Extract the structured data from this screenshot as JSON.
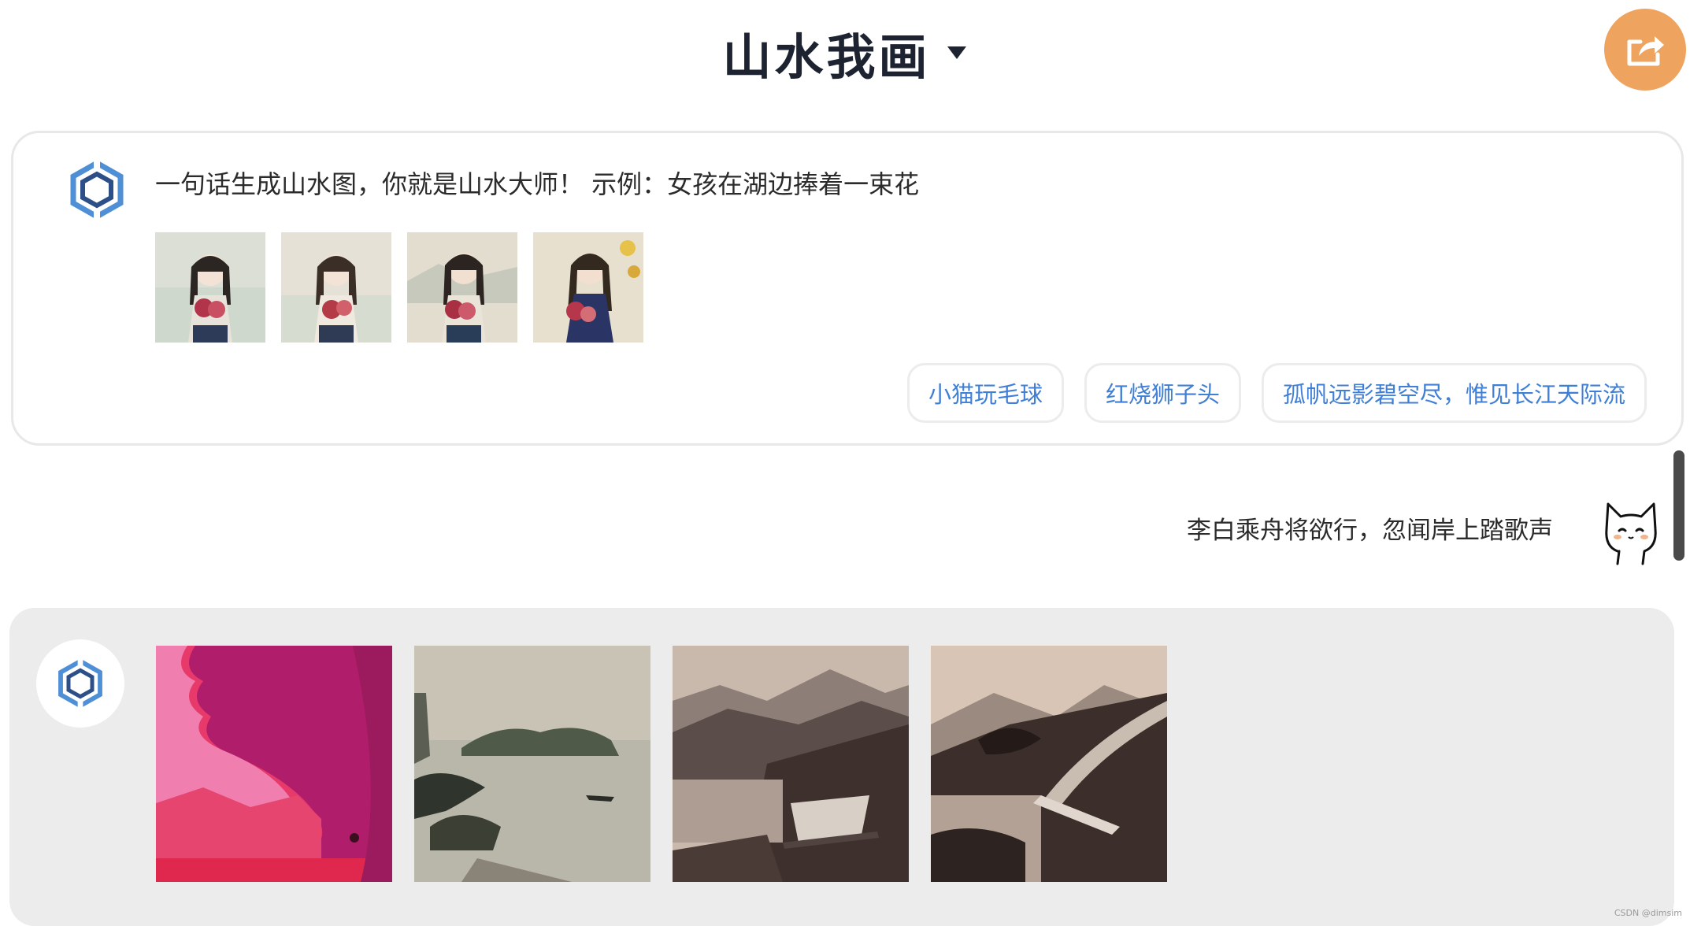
{
  "header": {
    "title": "山水我画",
    "share_icon": "share-icon",
    "accent_color": "#eea35f"
  },
  "bot_intro": {
    "text": "一句话生成山水图，你就是山水大师！ 示例：女孩在湖边捧着一束花",
    "example_images": [
      "girl-with-flowers-1",
      "girl-with-flowers-2",
      "girl-with-flowers-3",
      "girl-with-flowers-4"
    ],
    "suggestions": [
      "小猫玩毛球",
      "红烧狮子头",
      "孤帆远影碧空尽，惟见长江天际流"
    ]
  },
  "user_message": {
    "text": "李白乘舟将欲行，忽闻岸上踏歌声",
    "avatar": "cat-avatar"
  },
  "bot_result": {
    "images": [
      "pink-landscape",
      "lake-boat-landscape",
      "misty-mountains-bridge",
      "sepia-mountain-bridge"
    ]
  },
  "footer": {
    "watermark": "CSDN @dimsim"
  }
}
